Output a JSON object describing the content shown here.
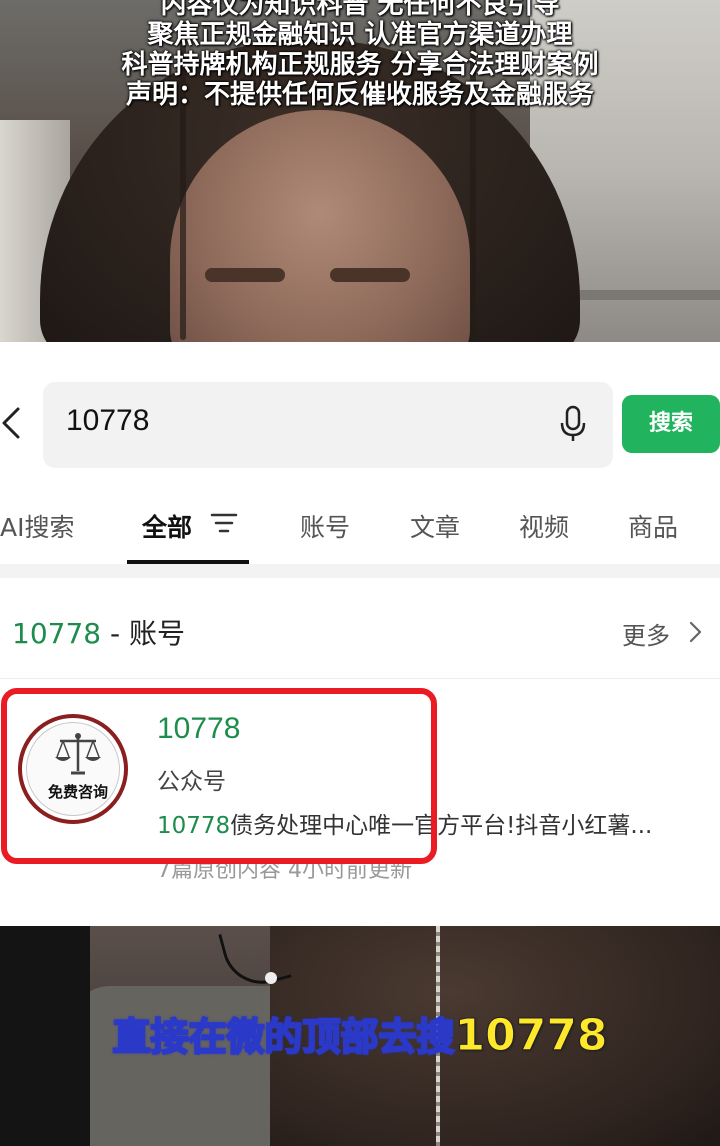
{
  "notice_lines": [
    "内容仅为知识科普 无任何不良引导",
    "聚焦正规金融知识 认准官方渠道办理",
    "科普持牌机构正规服务 分享合法理财案例",
    "声明：不提供任何反催收服务及金融服务"
  ],
  "search": {
    "query": "10778",
    "button_label": "搜索"
  },
  "tabs": [
    "AI搜索",
    "全部",
    "账号",
    "文章",
    "视频",
    "商品"
  ],
  "section": {
    "keyword": "10778",
    "suffix": " - 账号",
    "more_label": "更多"
  },
  "account": {
    "name": "10778",
    "type": "公众号",
    "desc_highlight": "10778",
    "desc_rest": "债务处理中心唯一官方平台!抖音小红薯...",
    "meta": "7篇原创内容  4小时前更新",
    "avatar_label": "免费咨询"
  },
  "caption": {
    "text": "直接在微的顶部去搜",
    "number": "10778"
  },
  "colors": {
    "accent_green": "#22b35e",
    "link_green": "#1c8d4c",
    "highlight_red": "#ea1b23"
  }
}
